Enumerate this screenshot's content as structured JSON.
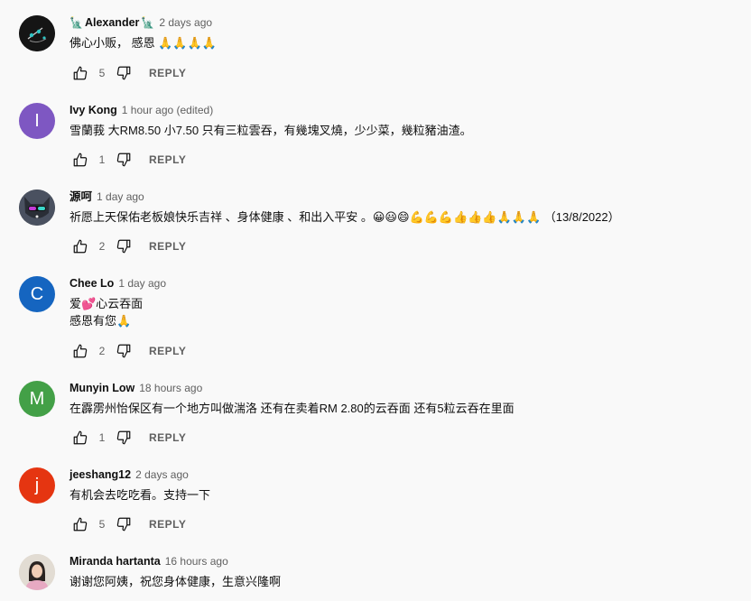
{
  "labels": {
    "reply": "REPLY"
  },
  "comments": [
    {
      "author": "Alexander",
      "author_prefix": "🗽",
      "author_suffix": "🗽",
      "time": "2 days ago",
      "text": "佛心小贩， 感恩 🙏🙏🙏🙏",
      "likes": "5",
      "avatar_kind": "image",
      "avatar_color": "#1a1a1a"
    },
    {
      "author": "Ivy Kong",
      "time": "1 hour ago (edited)",
      "text": "雪蘭莪 大RM8.50  小7.50 只有三粒雲吞，有幾塊叉燒，少少菜，幾粒豬油渣。",
      "likes": "1",
      "avatar_kind": "letter",
      "avatar_letter": "I",
      "avatar_color": "#7e57c2"
    },
    {
      "author": "源呵",
      "time": "1 day ago",
      "text": "祈愿上天保佑老板娘快乐吉祥 、身体健康 、和出入平安 。😀😃😄💪💪💪👍👍👍🙏🙏🙏 （13/8/2022）",
      "likes": "2",
      "avatar_kind": "image",
      "avatar_color": "#3a3f48"
    },
    {
      "author": "Chee Lo",
      "time": "1 day ago",
      "text": "爱💕心云吞面",
      "text2": "感恩有您🙏",
      "likes": "2",
      "avatar_kind": "letter",
      "avatar_letter": "C",
      "avatar_color": "#1565c0"
    },
    {
      "author": "Munyin Low",
      "time": "18 hours ago",
      "text": "在霹雳州怡保区有一个地方叫做湍洛 还有在卖着RM 2.80的云吞面 还有5粒云吞在里面",
      "likes": "1",
      "avatar_kind": "letter",
      "avatar_letter": "M",
      "avatar_color": "#43a047"
    },
    {
      "author": "jeeshang12",
      "time": "2 days ago",
      "text": "有机会去吃吃看。支持一下",
      "likes": "5",
      "avatar_kind": "letter",
      "avatar_letter": "j",
      "avatar_color": "#e53511"
    },
    {
      "author": "Miranda hartanta",
      "time": "16 hours ago",
      "text": "谢谢您阿姨，祝您身体健康，生意兴隆啊",
      "likes": "",
      "avatar_kind": "image",
      "avatar_color": "#d8cfc4"
    }
  ]
}
